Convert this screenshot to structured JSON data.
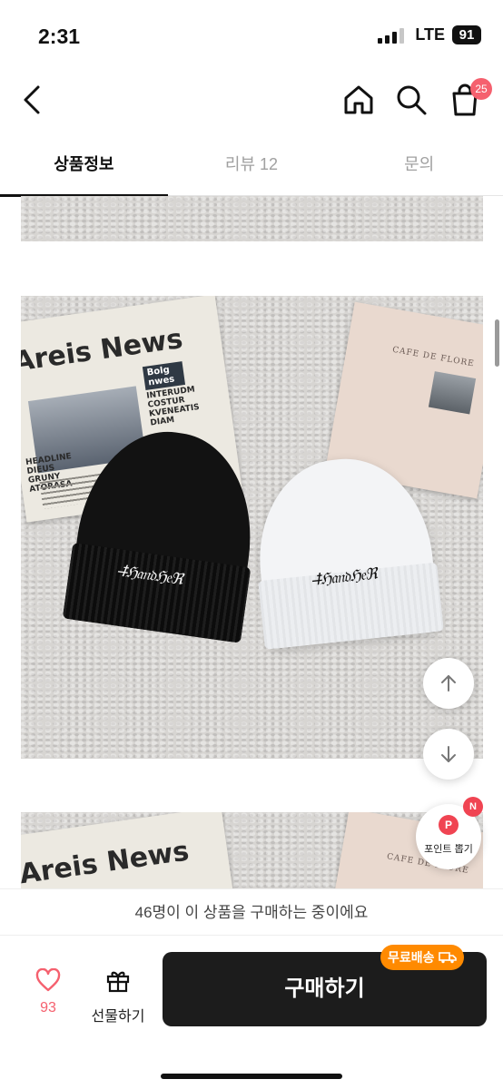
{
  "status_bar": {
    "time": "2:31",
    "network": "LTE",
    "battery": "91"
  },
  "header": {
    "cart_count": "25"
  },
  "tabs": [
    {
      "label": "상품정보",
      "active": true
    },
    {
      "label": "리뷰 12",
      "active": false
    },
    {
      "label": "문의",
      "active": false
    }
  ],
  "product_image": {
    "newspaper_headline": "Areis News",
    "newspaper_small_box": "Bolg nwes",
    "newspaper_column": "INTERUDM COSTUR KVENEATIS DIAM",
    "newspaper_left_column": "HEADLINE DIEUS GRUNY ATORASA",
    "book_title": "CAFE DE FLORE"
  },
  "floating": {
    "points_label": "포인트 뽑기",
    "points_badge": "P",
    "points_new_badge": "N"
  },
  "bottom": {
    "buying_notice": "46명이 이 상품을 구매하는 중이에요",
    "like_count": "93",
    "gift_label": "선물하기",
    "buy_label": "구매하기",
    "free_shipping_label": "무료배송"
  },
  "colors": {
    "accent_pink": "#f5606e",
    "free_shipping": "#ff8a00",
    "buy_button": "#1c1c1c"
  }
}
